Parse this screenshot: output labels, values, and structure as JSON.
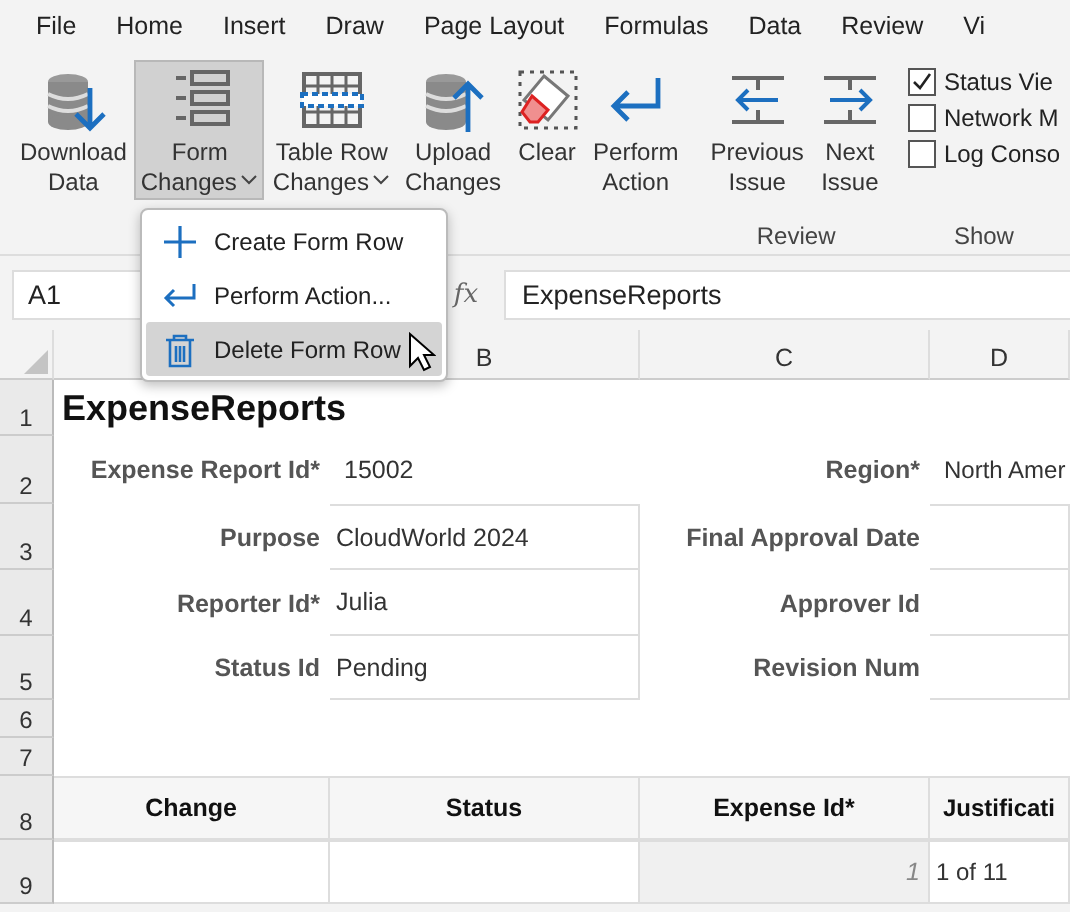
{
  "menu_tabs": [
    {
      "label": "File",
      "selected": false
    },
    {
      "label": "Home",
      "selected": false
    },
    {
      "label": "Insert",
      "selected": false
    },
    {
      "label": "Draw",
      "selected": false
    },
    {
      "label": "Page Layout",
      "selected": false
    },
    {
      "label": "Formulas",
      "selected": false
    },
    {
      "label": "Data",
      "selected": false
    },
    {
      "label": "Review",
      "selected": false
    },
    {
      "label": "Vi",
      "selected": false
    }
  ],
  "ribbon": {
    "groups": [
      {
        "buttons": [
          {
            "label": "Download\nData",
            "kind": "download",
            "dropdown": false,
            "selected": false
          },
          {
            "label": "Form\nChanges",
            "kind": "form",
            "dropdown": true,
            "selected": true
          },
          {
            "label": "Table Row\nChanges",
            "kind": "table",
            "dropdown": true,
            "selected": false
          },
          {
            "label": "Upload\nChanges",
            "kind": "upload",
            "dropdown": false,
            "selected": false
          },
          {
            "label": "Clear",
            "kind": "clear",
            "dropdown": false,
            "selected": false
          },
          {
            "label": "Perform\nAction",
            "kind": "action",
            "dropdown": false,
            "selected": false
          }
        ]
      },
      {
        "label": "Review",
        "buttons": [
          {
            "label": "Previous\nIssue",
            "kind": "previous",
            "dropdown": false,
            "selected": false
          },
          {
            "label": "Next\nIssue",
            "kind": "next",
            "dropdown": false,
            "selected": false
          }
        ]
      },
      {
        "label": "Show",
        "checkboxes": [
          {
            "label": "Status Vie",
            "checked": true
          },
          {
            "label": "Network M",
            "checked": false
          },
          {
            "label": "Log Conso",
            "checked": false
          }
        ]
      }
    ]
  },
  "dropdown_menu": {
    "items": [
      {
        "label": "Create Form Row",
        "kind": "plus",
        "selected": false
      },
      {
        "label": "Perform Action...",
        "kind": "enter",
        "selected": false
      },
      {
        "label": "Delete Form Row",
        "kind": "trash",
        "selected": true
      }
    ]
  },
  "formula_bar": {
    "name_box": "A1",
    "fx": "fx",
    "value": "ExpenseReports"
  },
  "sheet": {
    "columns": [
      "B",
      "C",
      "D"
    ],
    "rows": [
      {
        "number": "1",
        "cells": [
          {
            "kind": "title",
            "text": "ExpenseReports"
          }
        ]
      },
      {
        "number": "2",
        "cells": [
          {
            "kind": "label",
            "text": "Expense Report Id*"
          },
          {
            "kind": "value",
            "text": "15002"
          },
          {
            "kind": "label",
            "text": "Region*"
          },
          {
            "kind": "value",
            "text": "North Amer"
          }
        ]
      },
      {
        "number": "3",
        "cells": [
          {
            "kind": "label",
            "text": "Purpose"
          },
          {
            "kind": "input",
            "text": "CloudWorld 2024"
          },
          {
            "kind": "label",
            "text": "Final Approval Date"
          },
          {
            "kind": "input"
          }
        ]
      },
      {
        "number": "4",
        "cells": [
          {
            "kind": "label",
            "text": "Reporter Id*"
          },
          {
            "kind": "input",
            "text": "Julia"
          },
          {
            "kind": "label",
            "text": "Approver Id"
          },
          {
            "kind": "input"
          }
        ]
      },
      {
        "number": "5",
        "cells": [
          {
            "kind": "label",
            "text": "Status Id"
          },
          {
            "kind": "input",
            "text": "Pending"
          },
          {
            "kind": "label",
            "text": "Revision Num"
          },
          {
            "kind": "input"
          }
        ]
      },
      {
        "number": "6"
      },
      {
        "number": "7"
      },
      {
        "number": "8",
        "cells": [
          {
            "kind": "header",
            "text": "Change"
          },
          {
            "kind": "header",
            "text": "Status"
          },
          {
            "kind": "header",
            "text": "Expense Id*"
          },
          {
            "kind": "header",
            "text": "Justificati"
          }
        ]
      },
      {
        "number": "9",
        "cells": [
          {
            "kind": "input"
          },
          {
            "kind": "input"
          },
          {
            "kind": "index",
            "text": "1"
          },
          {
            "kind": "input",
            "text": "1 of 11"
          }
        ]
      }
    ]
  }
}
